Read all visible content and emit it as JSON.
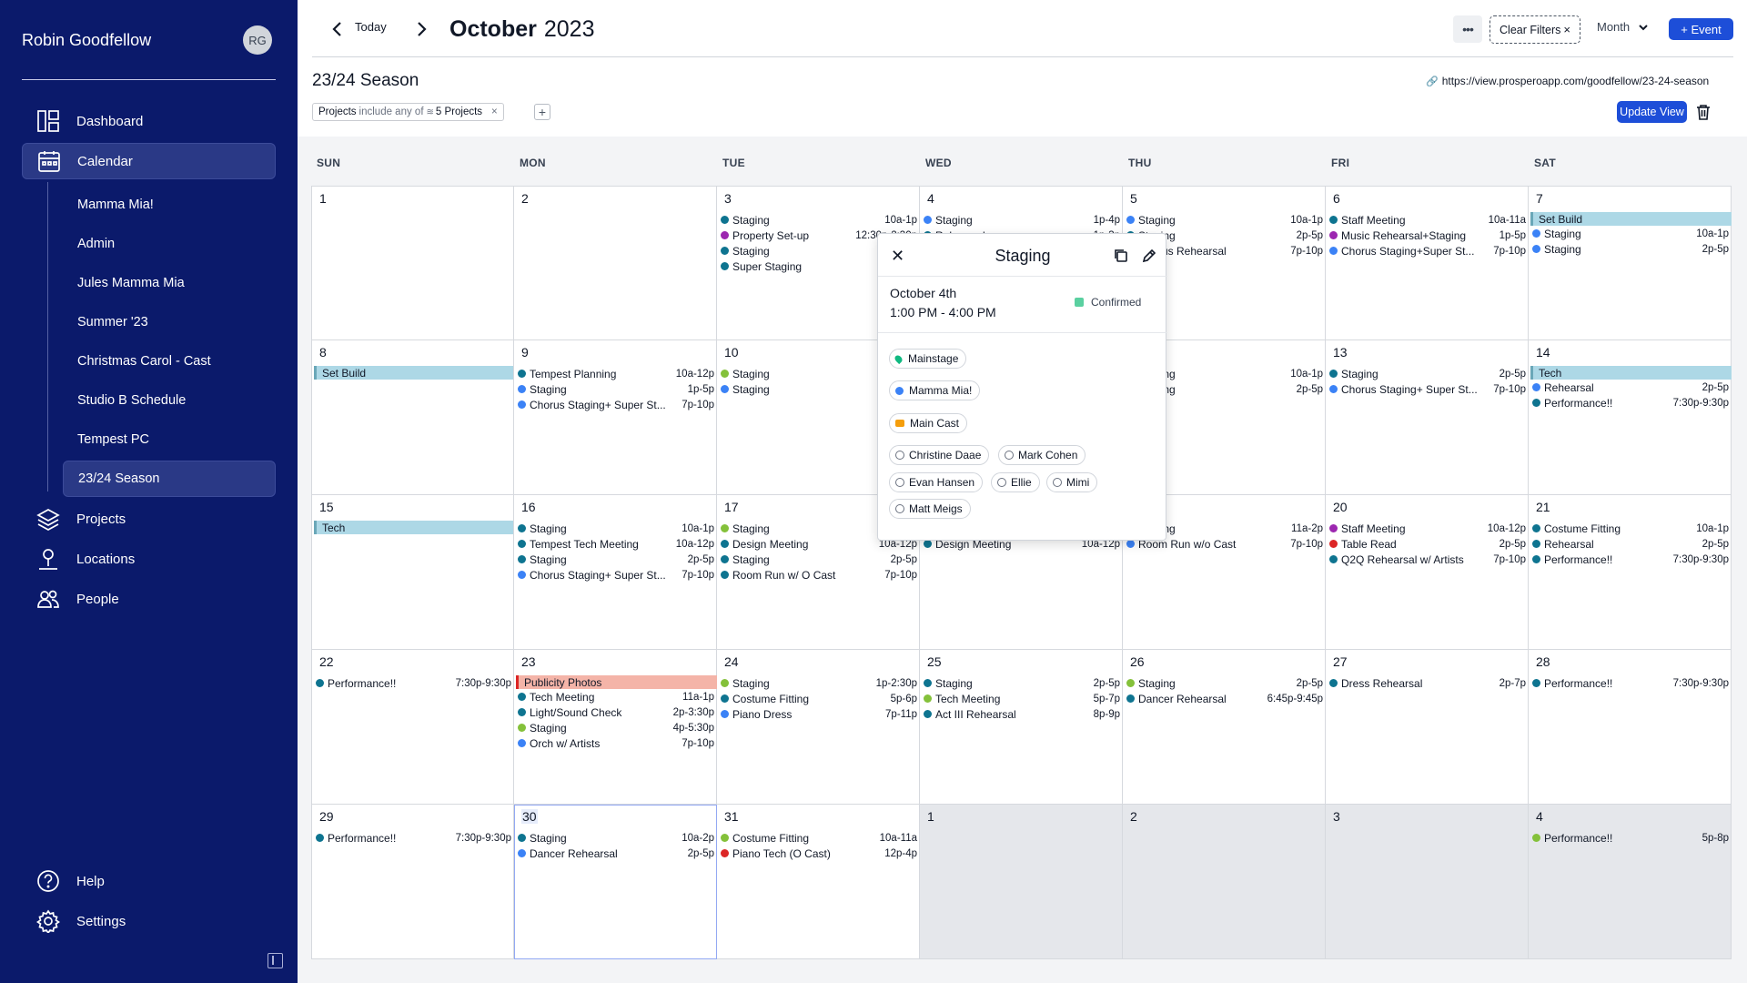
{
  "user": {
    "name": "Robin Goodfellow",
    "initials": "RG"
  },
  "nav": {
    "dashboard": "Dashboard",
    "calendar": "Calendar",
    "calendars": [
      "Mamma Mia!",
      "Admin",
      "Jules Mamma Mia",
      "Summer '23",
      "Christmas Carol - Cast",
      "Studio B Schedule",
      "Tempest PC",
      "23/24 Season"
    ],
    "projects": "Projects",
    "locations": "Locations",
    "people": "People",
    "help": "Help",
    "settings": "Settings"
  },
  "toolbar": {
    "today": "Today",
    "month_name": "October",
    "year": "2023",
    "more": "•••",
    "clear_filters": "Clear Filters",
    "view_mode": "Month",
    "add_event": "+ Event",
    "update_view": "Update View"
  },
  "view": {
    "title": "23/24 Season",
    "share_url": "https://view.prosperoapp.com/goodfellow/23-24-season",
    "filter": {
      "field": "Projects",
      "op": "include any of",
      "value": "5 Projects"
    }
  },
  "weekdays": [
    "SUN",
    "MON",
    "TUE",
    "WED",
    "THU",
    "FRI",
    "SAT"
  ],
  "colors": {
    "teal": "#0e7490",
    "blue": "#3b82f6",
    "green": "#84c13a",
    "purple": "#9c27b0",
    "red": "#dc2626",
    "setbuild": "#add8e6",
    "publicity": "#f4b4a8",
    "accent": "#1d4ed8"
  },
  "weeks": [
    [
      {
        "d": "1",
        "events": []
      },
      {
        "d": "2",
        "events": []
      },
      {
        "d": "3",
        "events": [
          {
            "c": "teal",
            "t": "Staging",
            "tm": "10a-1p"
          },
          {
            "c": "purple",
            "t": "Property Set-up",
            "tm": "12:30p-2:30p"
          },
          {
            "c": "teal",
            "t": "Staging",
            "tm": ""
          },
          {
            "c": "teal",
            "t": "Super Staging",
            "tm": ""
          }
        ]
      },
      {
        "d": "4",
        "events": [
          {
            "c": "blue",
            "t": "Staging",
            "tm": "1p-4p"
          },
          {
            "c": "teal",
            "t": "Rehearsal",
            "tm": "1p-3p"
          }
        ]
      },
      {
        "d": "5",
        "events": [
          {
            "c": "blue",
            "t": "Staging",
            "tm": "10a-1p"
          },
          {
            "c": "teal",
            "t": "Staging",
            "tm": "2p-5p"
          },
          {
            "c": "teal",
            "t": "Chorus Rehearsal",
            "tm": "7p-10p"
          }
        ]
      },
      {
        "d": "6",
        "events": [
          {
            "c": "teal",
            "t": "Staff Meeting",
            "tm": "10a-11a"
          },
          {
            "c": "purple",
            "t": "Music Rehearsal+Staging",
            "tm": "1p-5p"
          },
          {
            "c": "blue",
            "t": "Chorus Staging+Super St...",
            "tm": "7p-10p"
          }
        ]
      },
      {
        "d": "7",
        "bar": {
          "c": "setbuild",
          "t": "Set Build"
        },
        "events": [
          {
            "c": "blue",
            "t": "Staging",
            "tm": "10a-1p"
          },
          {
            "c": "blue",
            "t": "Staging",
            "tm": "2p-5p"
          }
        ]
      }
    ],
    [
      {
        "d": "8",
        "bar": {
          "c": "setbuild",
          "t": "Set Build"
        },
        "events": []
      },
      {
        "d": "9",
        "events": [
          {
            "c": "teal",
            "t": "Tempest Planning",
            "tm": "10a-12p"
          },
          {
            "c": "blue",
            "t": "Staging",
            "tm": "1p-5p"
          },
          {
            "c": "blue",
            "t": "Chorus Staging+ Super St...",
            "tm": "7p-10p"
          }
        ]
      },
      {
        "d": "10",
        "events": [
          {
            "c": "green",
            "t": "Staging",
            "tm": ""
          },
          {
            "c": "blue",
            "t": "Staging",
            "tm": ""
          }
        ]
      },
      {
        "d": "11",
        "events": []
      },
      {
        "d": "12",
        "events": [
          {
            "c": "teal",
            "t": "Staging",
            "tm": "10a-1p"
          },
          {
            "c": "blue",
            "t": "Staging",
            "tm": "2p-5p"
          }
        ]
      },
      {
        "d": "13",
        "events": [
          {
            "c": "teal",
            "t": "Staging",
            "tm": "2p-5p"
          },
          {
            "c": "blue",
            "t": "Chorus Staging+ Super St...",
            "tm": "7p-10p"
          }
        ]
      },
      {
        "d": "14",
        "bar": {
          "c": "setbuild",
          "t": "Tech"
        },
        "events": [
          {
            "c": "blue",
            "t": "Rehearsal",
            "tm": "2p-5p"
          },
          {
            "c": "teal",
            "t": "Performance!!",
            "tm": "7:30p-9:30p"
          }
        ]
      }
    ],
    [
      {
        "d": "15",
        "bar": {
          "c": "setbuild",
          "t": "Tech"
        },
        "events": []
      },
      {
        "d": "16",
        "events": [
          {
            "c": "teal",
            "t": "Staging",
            "tm": "10a-1p"
          },
          {
            "c": "teal",
            "t": "Tempest Tech Meeting",
            "tm": "10a-12p"
          },
          {
            "c": "teal",
            "t": "Staging",
            "tm": "2p-5p"
          },
          {
            "c": "blue",
            "t": "Chorus Staging+ Super St...",
            "tm": "7p-10p"
          }
        ]
      },
      {
        "d": "17",
        "events": [
          {
            "c": "green",
            "t": "Staging",
            "tm": "10a-1p"
          },
          {
            "c": "teal",
            "t": "Design Meeting",
            "tm": "10a-12p"
          },
          {
            "c": "teal",
            "t": "Staging",
            "tm": "2p-5p"
          },
          {
            "c": "teal",
            "t": "Room Run w/ O Cast",
            "tm": "7p-10p"
          }
        ]
      },
      {
        "d": "18",
        "events": [
          {
            "c": "teal",
            "t": "Staging",
            "tm": ""
          },
          {
            "c": "teal",
            "t": "Design Meeting",
            "tm": "10a-12p"
          }
        ]
      },
      {
        "d": "19",
        "events": [
          {
            "c": "teal",
            "t": "Staging",
            "tm": "11a-2p"
          },
          {
            "c": "blue",
            "t": "Room Run w/o Cast",
            "tm": "7p-10p"
          }
        ]
      },
      {
        "d": "20",
        "events": [
          {
            "c": "purple",
            "t": "Staff Meeting",
            "tm": "10a-12p"
          },
          {
            "c": "red",
            "t": "Table Read",
            "tm": "2p-5p"
          },
          {
            "c": "teal",
            "t": "Q2Q Rehearsal w/ Artists",
            "tm": "7p-10p"
          }
        ]
      },
      {
        "d": "21",
        "events": [
          {
            "c": "teal",
            "t": "Costume Fitting",
            "tm": "10a-1p"
          },
          {
            "c": "teal",
            "t": "Rehearsal",
            "tm": "2p-5p"
          },
          {
            "c": "teal",
            "t": "Performance!!",
            "tm": "7:30p-9:30p"
          }
        ]
      }
    ],
    [
      {
        "d": "22",
        "events": [
          {
            "c": "teal",
            "t": "Performance!!",
            "tm": "7:30p-9:30p"
          }
        ]
      },
      {
        "d": "23",
        "bar": {
          "c": "publicity",
          "t": "Publicity Photos"
        },
        "events": [
          {
            "c": "teal",
            "t": "Tech Meeting",
            "tm": "11a-1p"
          },
          {
            "c": "teal",
            "t": "Light/Sound Check",
            "tm": "2p-3:30p"
          },
          {
            "c": "green",
            "t": "Staging",
            "tm": "4p-5:30p"
          },
          {
            "c": "blue",
            "t": "Orch w/ Artists",
            "tm": "7p-10p"
          }
        ]
      },
      {
        "d": "24",
        "events": [
          {
            "c": "green",
            "t": "Staging",
            "tm": "1p-2:30p"
          },
          {
            "c": "teal",
            "t": "Costume Fitting",
            "tm": "5p-6p"
          },
          {
            "c": "blue",
            "t": "Piano Dress",
            "tm": "7p-11p"
          }
        ]
      },
      {
        "d": "25",
        "events": [
          {
            "c": "teal",
            "t": "Staging",
            "tm": "2p-5p"
          },
          {
            "c": "green",
            "t": "Tech Meeting",
            "tm": "5p-7p"
          },
          {
            "c": "teal",
            "t": "Act III Rehearsal",
            "tm": "8p-9p"
          }
        ]
      },
      {
        "d": "26",
        "events": [
          {
            "c": "green",
            "t": "Staging",
            "tm": "2p-5p"
          },
          {
            "c": "teal",
            "t": "Dancer Rehearsal",
            "tm": "6:45p-9:45p"
          }
        ]
      },
      {
        "d": "27",
        "events": [
          {
            "c": "teal",
            "t": "Dress Rehearsal",
            "tm": "2p-7p"
          }
        ]
      },
      {
        "d": "28",
        "events": [
          {
            "c": "teal",
            "t": "Performance!!",
            "tm": "7:30p-9:30p"
          }
        ]
      }
    ],
    [
      {
        "d": "29",
        "events": [
          {
            "c": "teal",
            "t": "Performance!!",
            "tm": "7:30p-9:30p"
          }
        ]
      },
      {
        "d": "30",
        "today": true,
        "events": [
          {
            "c": "teal",
            "t": "Staging",
            "tm": "10a-2p"
          },
          {
            "c": "blue",
            "t": "Dancer Rehearsal",
            "tm": "2p-5p"
          }
        ]
      },
      {
        "d": "31",
        "events": [
          {
            "c": "green",
            "t": "Costume Fitting",
            "tm": "10a-11a"
          },
          {
            "c": "red",
            "t": "Piano Tech (O Cast)",
            "tm": "12p-4p"
          }
        ]
      },
      {
        "d": "1",
        "other": true,
        "events": []
      },
      {
        "d": "2",
        "other": true,
        "events": []
      },
      {
        "d": "3",
        "other": true,
        "events": []
      },
      {
        "d": "4",
        "other": true,
        "events": [
          {
            "c": "green",
            "t": "Performance!!",
            "tm": "5p-8p"
          }
        ]
      }
    ]
  ],
  "popup": {
    "title": "Staging",
    "date": "October 4th",
    "time": "1:00 PM - 4:00 PM",
    "status": "Confirmed",
    "location": "Mainstage",
    "project": "Mamma Mia!",
    "group": "Main Cast",
    "people": [
      "Christine Daae",
      "Mark Cohen",
      "Evan Hansen",
      "Ellie",
      "Mimi",
      "Matt Meigs"
    ]
  }
}
